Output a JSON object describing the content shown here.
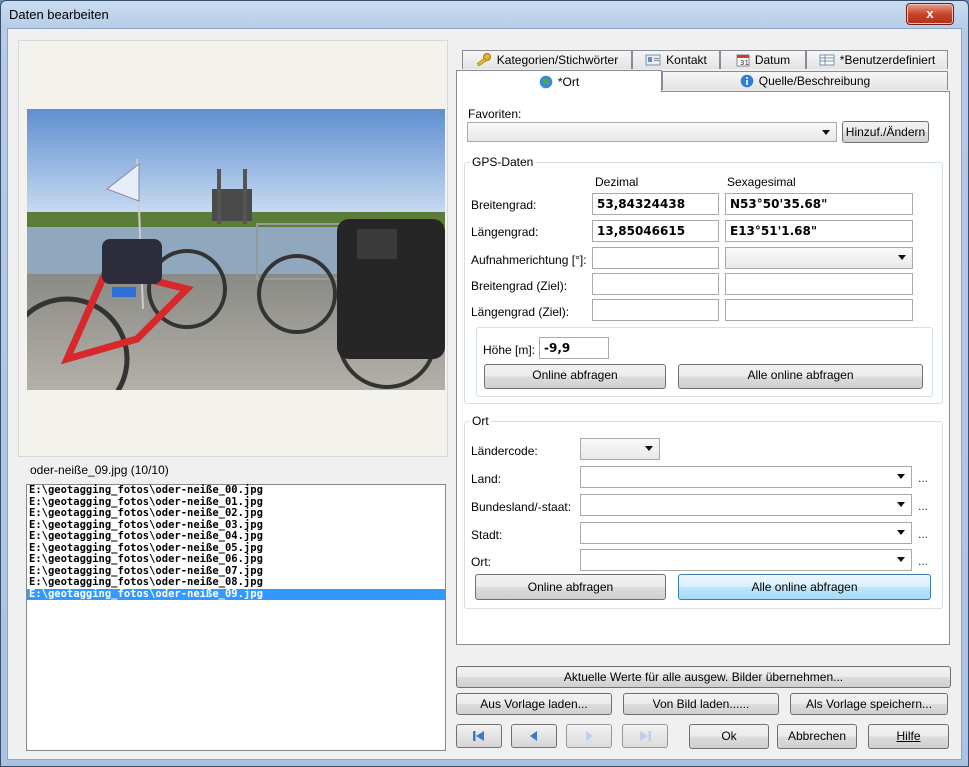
{
  "window": {
    "title": "Daten bearbeiten",
    "close": "x"
  },
  "preview": {
    "filename": "oder-neiße_09.jpg (10/10)"
  },
  "files": [
    "E:\\geotagging_fotos\\oder-neiße_00.jpg",
    "E:\\geotagging_fotos\\oder-neiße_01.jpg",
    "E:\\geotagging_fotos\\oder-neiße_02.jpg",
    "E:\\geotagging_fotos\\oder-neiße_03.jpg",
    "E:\\geotagging_fotos\\oder-neiße_04.jpg",
    "E:\\geotagging_fotos\\oder-neiße_05.jpg",
    "E:\\geotagging_fotos\\oder-neiße_06.jpg",
    "E:\\geotagging_fotos\\oder-neiße_07.jpg",
    "E:\\geotagging_fotos\\oder-neiße_08.jpg",
    "E:\\geotagging_fotos\\oder-neiße_09.jpg"
  ],
  "tabs": {
    "kategorien": "Kategorien/Stichwörter",
    "kontakt": "Kontakt",
    "datum": "Datum",
    "benutzer": "*Benutzerdefiniert",
    "ort": "*Ort",
    "quelle": "Quelle/Beschreibung"
  },
  "favoriten": {
    "label": "Favoriten:",
    "button": "Hinzuf./Ändern"
  },
  "gps": {
    "group": "GPS-Daten",
    "col_dezimal": "Dezimal",
    "col_sexagesimal": "Sexagesimal",
    "breitengrad_label": "Breitengrad:",
    "breitengrad_dez": "53,84324438",
    "breitengrad_sex": "N53°50'35.68\"",
    "laengengrad_label": "Längengrad:",
    "laengengrad_dez": "13,85046615",
    "laengengrad_sex": "E13°51'1.68\"",
    "aufnahme_label": "Aufnahmerichtung [°]:",
    "breite_ziel_label": "Breitengrad (Ziel):",
    "laenge_ziel_label": "Längengrad (Ziel):",
    "hoehe_label": "Höhe [m]:",
    "hoehe_value": "-9,9",
    "online_button": "Online abfragen",
    "alle_online_button": "Alle online abfragen"
  },
  "ort": {
    "group": "Ort",
    "laendercode_label": "Ländercode:",
    "land_label": "Land:",
    "bundesland_label": "Bundesland/-staat:",
    "stadt_label": "Stadt:",
    "ort_label": "Ort:",
    "more": "...",
    "online_button": "Online abfragen",
    "alle_online_button": "Alle online abfragen"
  },
  "actions": {
    "apply_all": "Aktuelle Werte für alle ausgew. Bilder übernehmen...",
    "aus_vorlage": "Aus Vorlage laden...",
    "von_bild": "Von Bild laden......",
    "als_vorlage": "Als Vorlage speichern...",
    "ok": "Ok",
    "abbrechen": "Abbrechen",
    "hilfe": "Hilfe"
  },
  "colors": {
    "selection": "#3399ff",
    "accent_button": "#bee6fd"
  }
}
